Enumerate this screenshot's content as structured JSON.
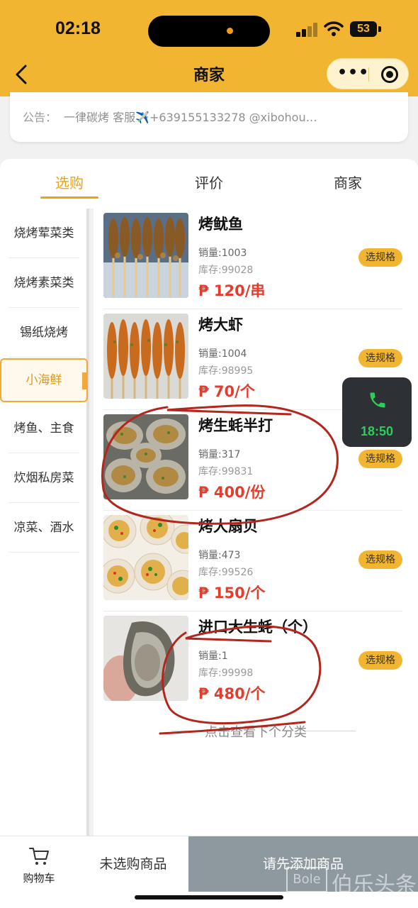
{
  "status_bar": {
    "time": "02:18",
    "battery": "53"
  },
  "nav": {
    "title": "商家"
  },
  "notice": {
    "label": "公告：",
    "text": "一律碳烤 客服✈️+639155133278 @xibohou…"
  },
  "tabs": [
    {
      "label": "选购"
    },
    {
      "label": "评价"
    },
    {
      "label": "商家"
    }
  ],
  "sidebar": {
    "items": [
      {
        "label": "烧烤荤菜类"
      },
      {
        "label": "烧烤素菜类"
      },
      {
        "label": "锡纸烧烤"
      },
      {
        "label": "小海鲜"
      },
      {
        "label": "烤鱼、主食"
      },
      {
        "label": "炊烟私房菜"
      },
      {
        "label": "凉菜、酒水"
      }
    ],
    "active_index": 3
  },
  "products": [
    {
      "name": "烤鱿鱼",
      "sales": "销量:1003",
      "stock": "库存:99028",
      "price": "₱ 120/串",
      "button": "选规格"
    },
    {
      "name": "烤大虾",
      "sales": "销量:1004",
      "stock": "库存:98995",
      "price": "₱ 70/个",
      "button": "选规格"
    },
    {
      "name": "烤生蚝半打",
      "sales": "销量:317",
      "stock": "库存:99831",
      "price": "₱ 400/份",
      "button": "选规格"
    },
    {
      "name": "烤大扇贝",
      "sales": "销量:473",
      "stock": "库存:99526",
      "price": "₱ 150/个",
      "button": "选规格"
    },
    {
      "name": "进口大生蚝（个）",
      "sales": "销量:1",
      "stock": "库存:99998",
      "price": "₱ 480/个",
      "button": "选规格"
    }
  ],
  "next_category": "点击查看下个分类",
  "phone_widget": {
    "time": "18:50"
  },
  "bottom_bar": {
    "cart_label": "购物车",
    "selected_text": "未选购商品",
    "submit_label": "请先添加商品"
  },
  "watermark": {
    "logo": "Bole",
    "text": "伯乐头条"
  },
  "colors": {
    "brand": "#f2b531",
    "accent": "#e9a21a",
    "price": "#e43d2d",
    "disabled": "#8d989f",
    "annotation": "#b3261e"
  }
}
